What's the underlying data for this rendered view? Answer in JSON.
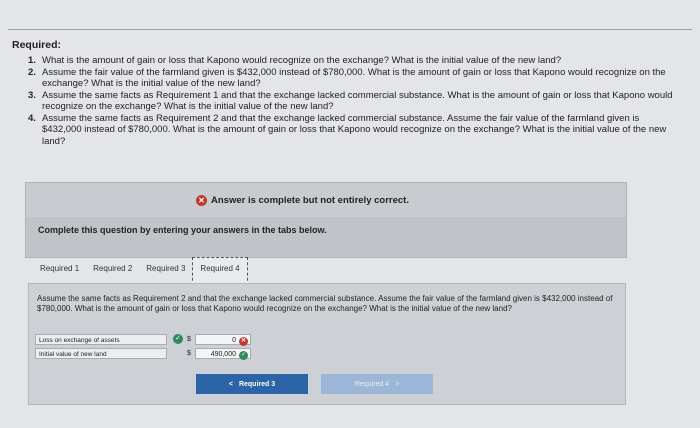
{
  "header": {
    "required_title": "Required:"
  },
  "questions": [
    {
      "num": "1.",
      "text": "What is the amount of gain or loss that Kapono would recognize on the exchange? What is the initial value of the new land?"
    },
    {
      "num": "2.",
      "text": "Assume the fair value of the farmland given is $432,000 instead of $780,000. What is the amount of gain or loss that Kapono would recognize on the exchange? What is the initial value of the new land?"
    },
    {
      "num": "3.",
      "text": "Assume the same facts as Requirement 1 and that the exchange lacked commercial substance. What is the amount of gain or loss that Kapono would recognize on the exchange? What is the initial value of the new land?"
    },
    {
      "num": "4.",
      "text": "Assume the same facts as Requirement 2 and that the exchange lacked commercial substance. Assume the fair value of the farmland given is $432,000 instead of $780,000. What is the amount of gain or loss that Kapono would recognize on the exchange? What is the initial value of the new land?"
    }
  ],
  "banner": {
    "text": "Answer is complete but not entirely correct."
  },
  "instructions": {
    "text": "Complete this question by entering your answers in the tabs below."
  },
  "tabs": [
    "Required 1",
    "Required 2",
    "Required 3",
    "Required 4"
  ],
  "active_tab": "Required 4",
  "prompt": "Assume the same facts as Requirement 2 and that the exchange lacked commercial substance. Assume the fair value of the farmland given is $432,000 instead of $780,000. What is the amount of gain or loss that Kapono would recognize on the exchange? What is the initial value of the new land?",
  "answers": [
    {
      "label": "Loss on exchange of assets",
      "currency": "$",
      "value": "0",
      "status": "incorrect"
    },
    {
      "label": "Initial value of new land",
      "currency": "$",
      "value": "490,000",
      "status": "correct"
    }
  ],
  "nav": {
    "prev_label": "Required 3",
    "next_label": "Required 4",
    "prev_glyph": "<",
    "next_glyph": ">"
  },
  "colors": {
    "correct": "#2f8a5c",
    "incorrect": "#c23a2b",
    "button": "#2c64a8"
  }
}
